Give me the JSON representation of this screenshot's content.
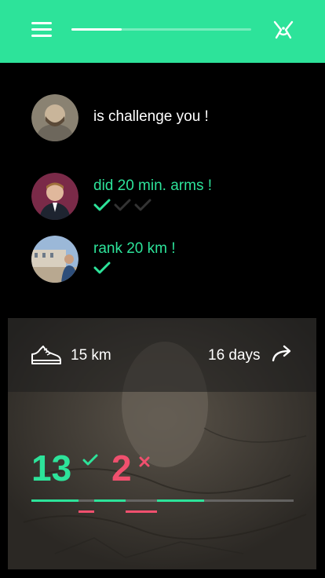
{
  "header": {
    "progress": 0.28,
    "colors": {
      "accent": "#2de39a",
      "fail": "#f0506e"
    },
    "menu_icon": "hamburger-icon",
    "logo_icon": "runner-logo-icon"
  },
  "feed": [
    {
      "text": "is challenge you !",
      "style": "white",
      "checks": []
    },
    {
      "text": "did 20 min. arms !",
      "style": "green",
      "checks": [
        "done",
        "pending",
        "pending"
      ]
    },
    {
      "text": "rank 20 km !",
      "style": "green",
      "checks": [
        "done"
      ]
    }
  ],
  "challenge": {
    "distance": "15 km",
    "duration": "16 days",
    "success_count": "13",
    "fail_count": "2",
    "shoe_icon": "shoe-icon",
    "share_icon": "share-arrow-icon"
  }
}
